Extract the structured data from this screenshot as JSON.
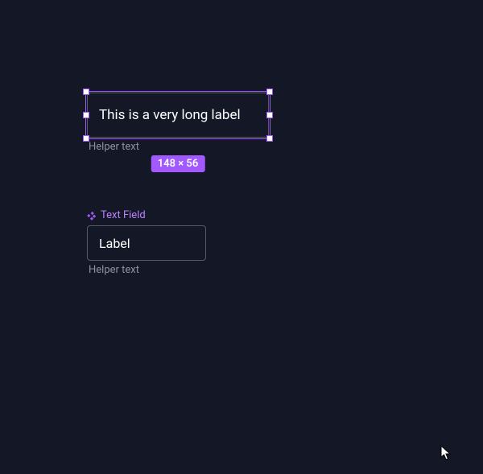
{
  "colors": {
    "selection": "#a259ff",
    "background": "#141826",
    "fieldBorder": "#55596a",
    "helper": "#8d91a0"
  },
  "selected": {
    "label": "This is a very long label",
    "helper": "Helper text",
    "dimensions": "148 × 56"
  },
  "component": {
    "name": "Text Field",
    "label": "Label",
    "helper": "Helper text"
  }
}
